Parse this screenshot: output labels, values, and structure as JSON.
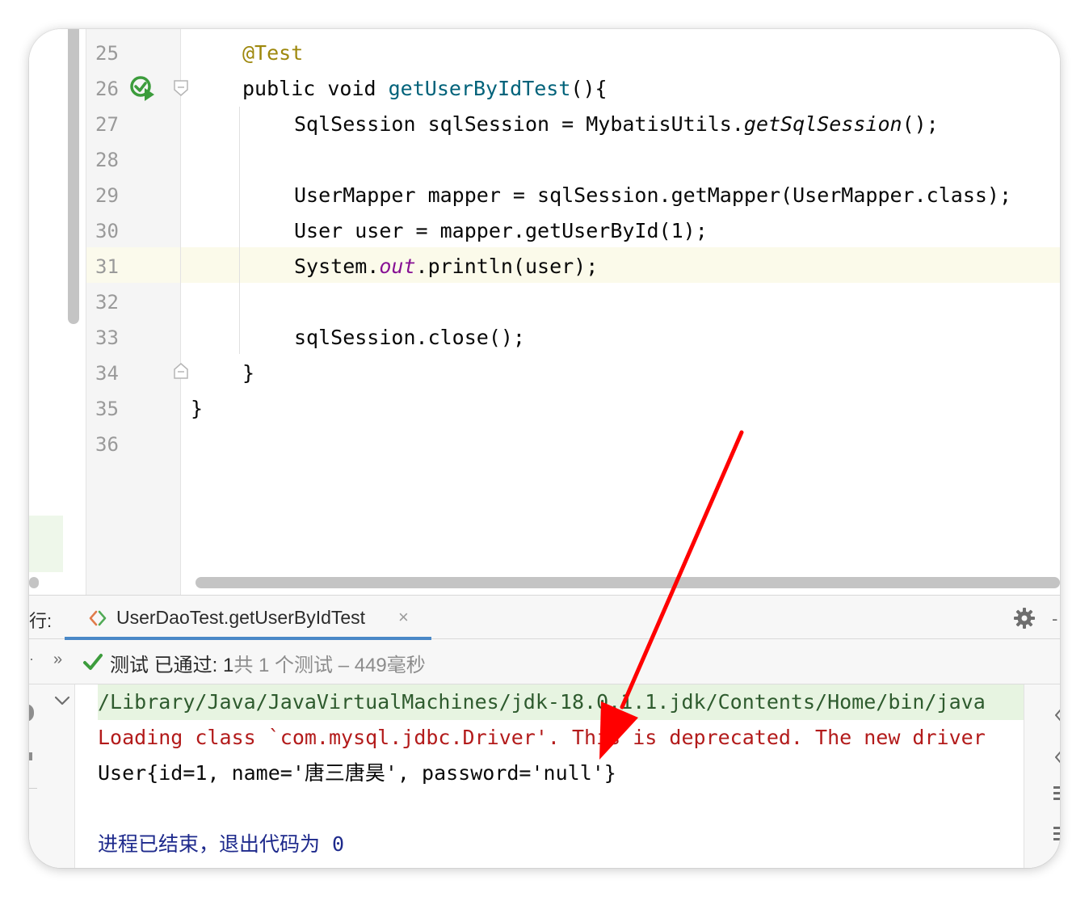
{
  "editor": {
    "lines": [
      {
        "number": "25",
        "code": "@Test"
      },
      {
        "number": "26",
        "code": "public void getUserByIdTest(){"
      },
      {
        "number": "27",
        "code": "SqlSession sqlSession = MybatisUtils.getSqlSession();"
      },
      {
        "number": "28",
        "code": ""
      },
      {
        "number": "29",
        "code": "UserMapper mapper = sqlSession.getMapper(UserMapper.class);"
      },
      {
        "number": "30",
        "code": "User user = mapper.getUserById(1);"
      },
      {
        "number": "31",
        "code": "System.out.println(user);"
      },
      {
        "number": "32",
        "code": ""
      },
      {
        "number": "33",
        "code": "sqlSession.close();"
      },
      {
        "number": "34",
        "code": "}"
      },
      {
        "number": "35",
        "code": "}"
      },
      {
        "number": "36",
        "code": ""
      }
    ],
    "current_line": "31"
  },
  "run_panel": {
    "label": "行:",
    "tab_title": "UserDaoTest.getUserByIdTest",
    "tab_close": "×",
    "status_passed": "测试 已通过: 1",
    "status_detail": "共 1 个测试 – 449毫秒",
    "expand_glyph": "»",
    "console": {
      "command": "/Library/Java/JavaVirtualMachines/jdk-18.0.1.1.jdk/Contents/Home/bin/java",
      "warning": "Loading class `com.mysql.jdbc.Driver'. This is deprecated. The new driver",
      "output": "User{id=1, name='唐三唐昊', password='null'}",
      "exit": "进程已结束，退出代码为 0"
    }
  },
  "colors": {
    "annotation": "#9e880d",
    "method": "#00627a",
    "static_field": "#871094",
    "error_text": "#b31b1b",
    "exit_text": "#1e2a8c",
    "passed_check": "#3c9c3c",
    "tab_underline": "#4a88c7",
    "arrow": "#ff0000"
  },
  "icons": [
    "run-test-icon",
    "fold-icon",
    "chevron-tab-icon",
    "close-icon",
    "gear-icon",
    "check-icon",
    "fold-down-icon",
    "scroll-bars-icon"
  ]
}
